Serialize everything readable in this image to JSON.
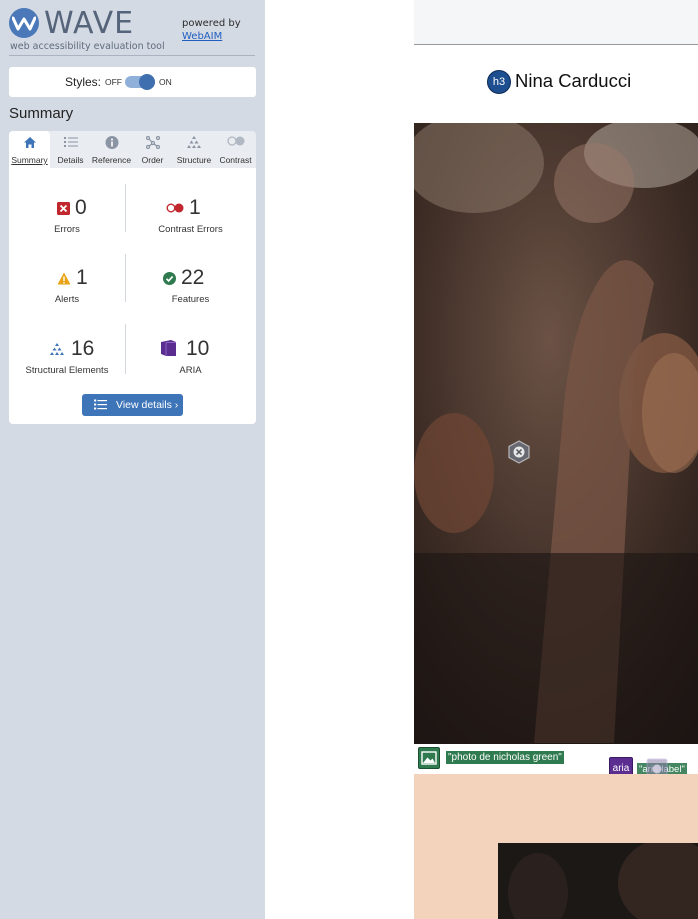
{
  "wave": {
    "logo_text": "WAVE",
    "tagline": "web accessibility evaluation tool",
    "powered_by": "powered by",
    "webaim_link": "WebAIM",
    "styles_label": "Styles:",
    "toggle_off": "OFF",
    "toggle_on": "ON",
    "summary_heading": "Summary",
    "tabs": [
      {
        "label": "Summary",
        "icon": "home-icon",
        "active": true
      },
      {
        "label": "Details",
        "icon": "list-icon"
      },
      {
        "label": "Reference",
        "icon": "info-icon"
      },
      {
        "label": "Order",
        "icon": "order-icon"
      },
      {
        "label": "Structure",
        "icon": "structure-icon"
      },
      {
        "label": "Contrast",
        "icon": "contrast-icon"
      }
    ],
    "stats": {
      "errors": {
        "count": "0",
        "label": "Errors",
        "color": "#c1272d"
      },
      "contrast_errors": {
        "count": "1",
        "label": "Contrast Errors",
        "color": "#c1272d"
      },
      "alerts": {
        "count": "1",
        "label": "Alerts",
        "color": "#e8a317"
      },
      "features": {
        "count": "22",
        "label": "Features",
        "color": "#2f7a4f"
      },
      "structural": {
        "count": "16",
        "label": "Structural Elements",
        "color": "#3d75b8"
      },
      "aria": {
        "count": "10",
        "label": "ARIA",
        "color": "#5b2d91"
      }
    },
    "view_details": "View details ›"
  },
  "page": {
    "heading_badge": "h3",
    "heading": "Nina Carducci",
    "alt_caption": "\"photo de nicholas green\"",
    "aria_badge": "aria",
    "aria_caption": "\"aria-label\""
  }
}
